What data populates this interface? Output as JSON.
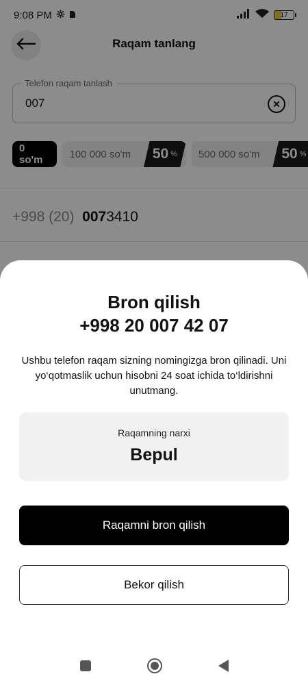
{
  "status": {
    "time": "9:08 PM",
    "battery": "17"
  },
  "header": {
    "title": "Raqam tanlang"
  },
  "search": {
    "label": "Telefon raqam tanlash",
    "value": "007"
  },
  "filters": {
    "active": "0 so'm",
    "chips": [
      {
        "label": "100 000 so'm",
        "badge": "50",
        "unit": "%"
      },
      {
        "label": "500 000 so'm",
        "badge": "50",
        "unit": "%"
      }
    ]
  },
  "list": {
    "row_prefix": "+998 (20)",
    "row_match": "007",
    "row_rest": "3410"
  },
  "sheet": {
    "title": "Bron qilish",
    "number": "+998 20 007 42 07",
    "description": "Ushbu telefon raqam sizning nomingizga bron qilinadi. Uni yo‘qotmaslik uchun hisobni 24 soat ichida to‘ldirishni unutmang.",
    "price_label": "Raqamning narxi",
    "price_value": "Bepul",
    "confirm": "Raqamni bron qilish",
    "cancel": "Bekor qilish"
  },
  "icons": {
    "back": "arrow-left-icon",
    "clear": "close-circle-icon",
    "settings": "gear-icon",
    "signal": "signal-icon",
    "wifi": "wifi-icon"
  }
}
